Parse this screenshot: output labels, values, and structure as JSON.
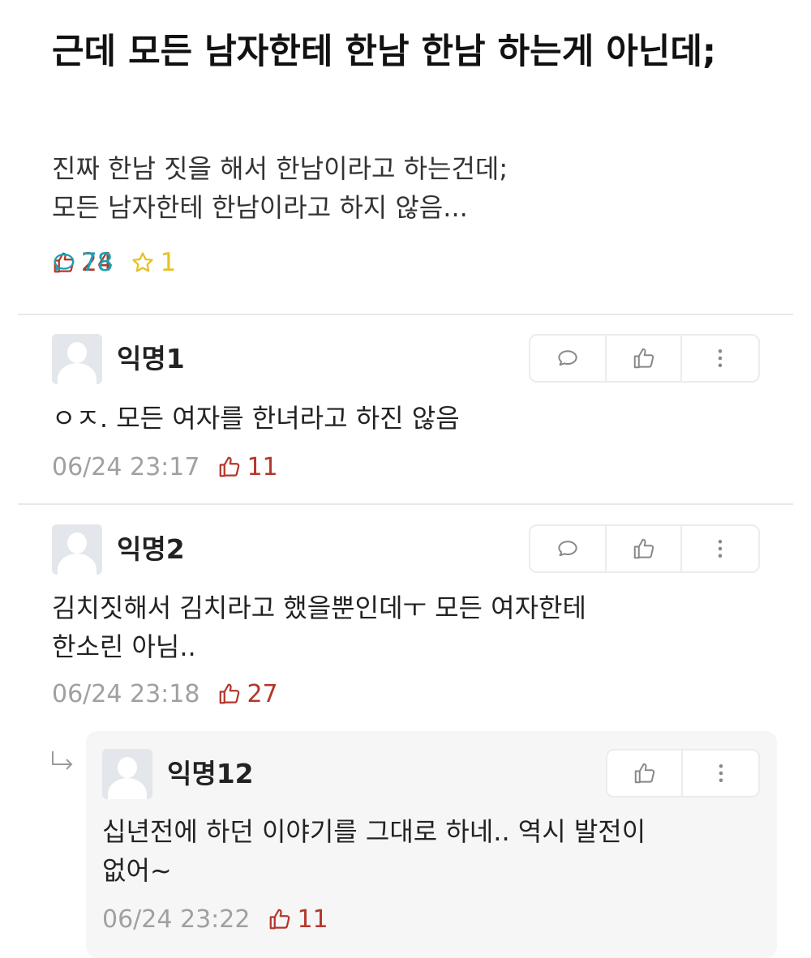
{
  "post": {
    "title": "근데 모든 남자한테 한남 한남 하는게 아닌데;",
    "body": "진짜 한남 짓을 해서 한남이라고 하는건데;\n모든 남자한테 한남이라고 하지 않음...",
    "likes": "24",
    "comments": "78",
    "scraps": "1"
  },
  "comments": [
    {
      "author": "익명1",
      "text": "ㅇㅈ. 모든 여자를 한녀라고 하진 않음",
      "time": "06/24 23:17",
      "likes": "11"
    },
    {
      "author": "익명2",
      "text": "김치짓해서 김치라고 했을뿐인데ㅜ 모든 여자한테\n한소린 아님..",
      "time": "06/24 23:18",
      "likes": "27"
    }
  ],
  "reply": {
    "author": "익명12",
    "text": "십년전에 하던 이야기를 그대로 하네.. 역시 발전이\n없어~",
    "time": "06/24 23:22",
    "likes": "11"
  },
  "colors": {
    "like": "#b3372a",
    "comment": "#1aa0b4",
    "scrap": "#e8c020",
    "meta": "#a0a0a0"
  },
  "icons": [
    "thumbs-up-icon",
    "speech-bubble-icon",
    "star-icon",
    "more-vertical-icon",
    "reply-arrow-icon",
    "avatar-icon"
  ]
}
